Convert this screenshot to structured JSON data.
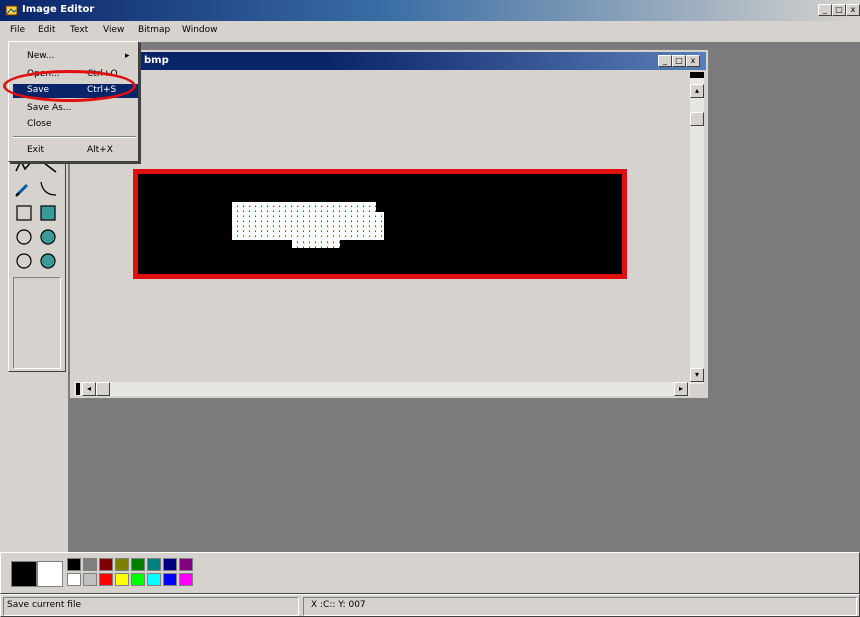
{
  "app": {
    "title": "Image Editor"
  },
  "window_buttons": {
    "minimize": "_",
    "maximize": "□",
    "close": "x"
  },
  "menubar": {
    "items": [
      "File",
      "Edit",
      "Text",
      "View",
      "Bitmap",
      "Window"
    ]
  },
  "child_window": {
    "title": "bmp"
  },
  "file_menu": {
    "items": [
      {
        "label": "New...",
        "shortcut": "",
        "has_submenu": true
      },
      {
        "label": "Open...",
        "shortcut": "Ctrl+O"
      },
      {
        "label": "Save",
        "shortcut": "Ctrl+S",
        "highlighted": true
      },
      {
        "label": "Save As...",
        "shortcut": ""
      },
      {
        "label": "Close",
        "shortcut": ""
      },
      {
        "label": "Exit",
        "shortcut": "Alt+X"
      }
    ],
    "submenu_arrow": "▸"
  },
  "annotation": {
    "color": "#e01010"
  },
  "palette": {
    "foreground": "#000000",
    "background": "#ffffff",
    "colors": [
      "#000000",
      "#808080",
      "#800000",
      "#808000",
      "#008000",
      "#008080",
      "#000080",
      "#800080",
      "#ffffff",
      "#c0c0c0",
      "#ff0000",
      "#ffff00",
      "#00ff00",
      "#00ffff",
      "#0000ff",
      "#ff00ff"
    ]
  },
  "status": {
    "message": "Save current file",
    "coords": "X :C:: Y: 007"
  },
  "scroll": {
    "left_arrow": "◂",
    "right_arrow": "▸",
    "up_arrow": "▴",
    "down_arrow": "▾"
  }
}
